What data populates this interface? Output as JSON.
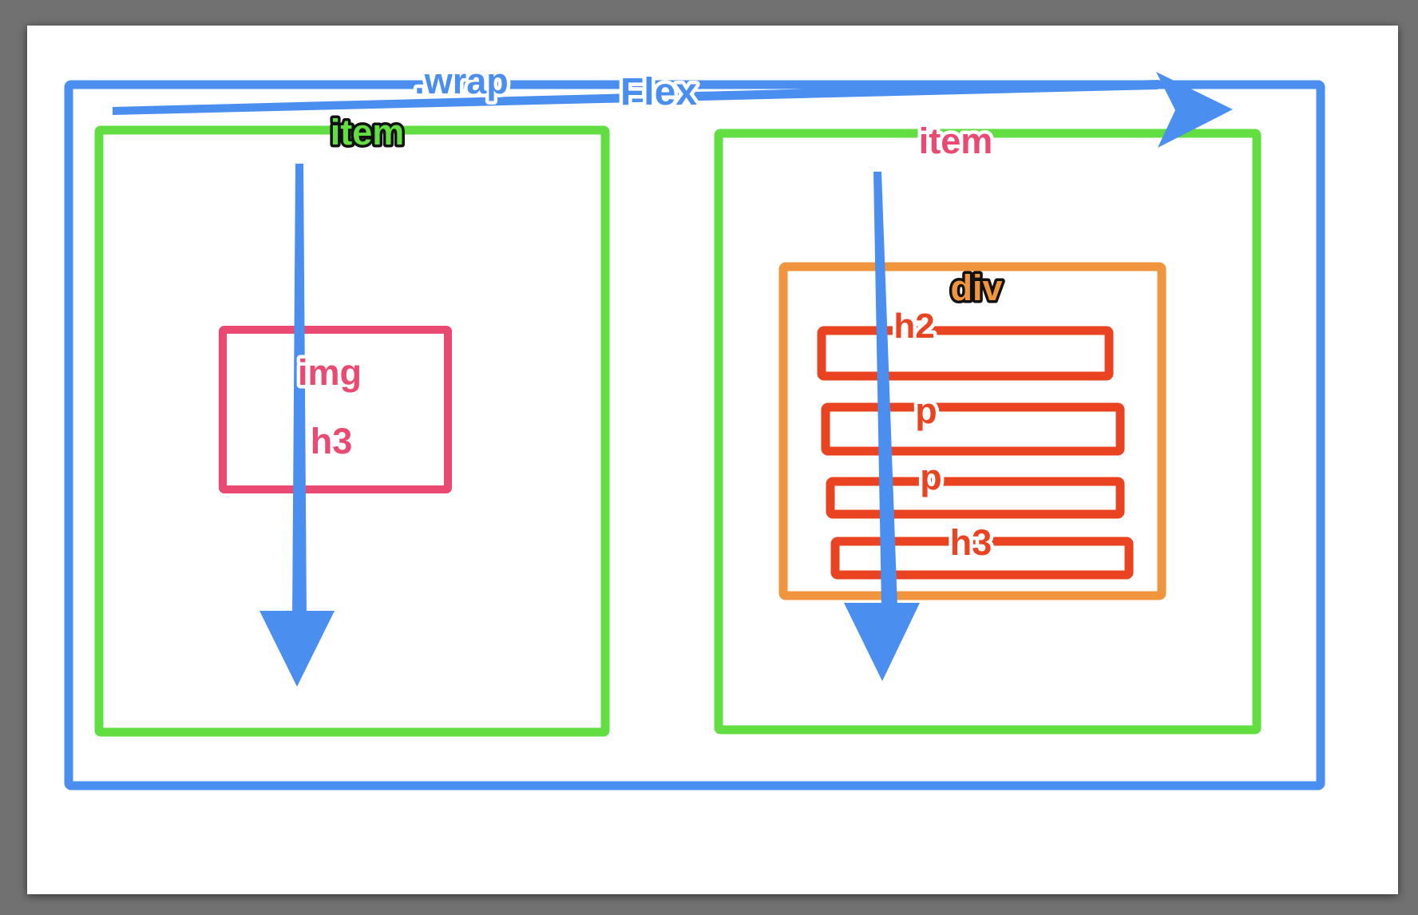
{
  "colors": {
    "background": "#717171",
    "paper": "#ffffff",
    "wrap": "#4a8ef0",
    "item": "#62de42",
    "inner_box": "#ea4a72",
    "div": "#f0953d",
    "children": "#ea4322",
    "arrow": "#4a8ef0"
  },
  "labels": {
    "wrap": ".wrap",
    "flex": "Flex",
    "item_left": "item",
    "item_right": "item",
    "img": "img",
    "h3_left": "h3",
    "div": "div",
    "h2": "h2",
    "p1": "p",
    "p2": "p",
    "h3_right": "h3"
  },
  "icons": {
    "flex_direction": "arrow-right-icon",
    "item_left_direction": "arrow-down-icon",
    "item_right_direction": "arrow-down-icon"
  }
}
